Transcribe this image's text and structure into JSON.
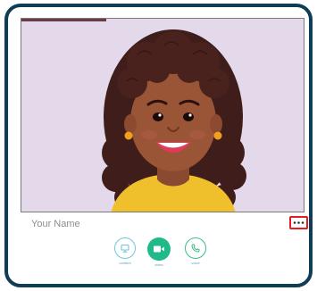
{
  "participant": {
    "name_placeholder": "Your Name",
    "video_progress": 0.3
  },
  "menu": {
    "more_icon": "ellipsis-icon"
  },
  "controls": [
    {
      "label": "content",
      "icon": "screen-share-icon",
      "color": "#6ec7d8"
    },
    {
      "label": "video",
      "icon": "video-camera-icon",
      "color": "#1fb98a"
    },
    {
      "label": "voice",
      "icon": "phone-icon",
      "color": "#3dbb88"
    }
  ],
  "colors": {
    "frame_border": "#0f3d55",
    "tile_background": "#e4d9ea",
    "highlight": "#e02020",
    "accent": "#1fb98a"
  }
}
